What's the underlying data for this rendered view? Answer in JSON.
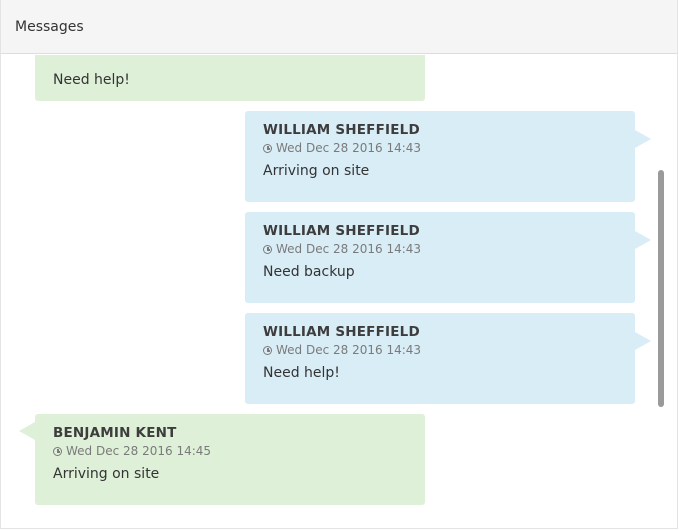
{
  "panel": {
    "title": "Messages"
  },
  "messages": [
    {
      "side": "left",
      "sender": "",
      "time": "",
      "text": "Need help!"
    },
    {
      "side": "right",
      "sender": "WILLIAM SHEFFIELD",
      "time": "Wed Dec 28 2016 14:43",
      "text": "Arriving on site"
    },
    {
      "side": "right",
      "sender": "WILLIAM SHEFFIELD",
      "time": "Wed Dec 28 2016 14:43",
      "text": "Need backup"
    },
    {
      "side": "right",
      "sender": "WILLIAM SHEFFIELD",
      "time": "Wed Dec 28 2016 14:43",
      "text": "Need help!"
    },
    {
      "side": "left",
      "sender": "BENJAMIN KENT",
      "time": "Wed Dec 28 2016 14:45",
      "text": "Arriving on site"
    }
  ],
  "colors": {
    "left_bubble": "#dff0d8",
    "right_bubble": "#d9edf7",
    "header_bg": "#f5f5f5"
  }
}
